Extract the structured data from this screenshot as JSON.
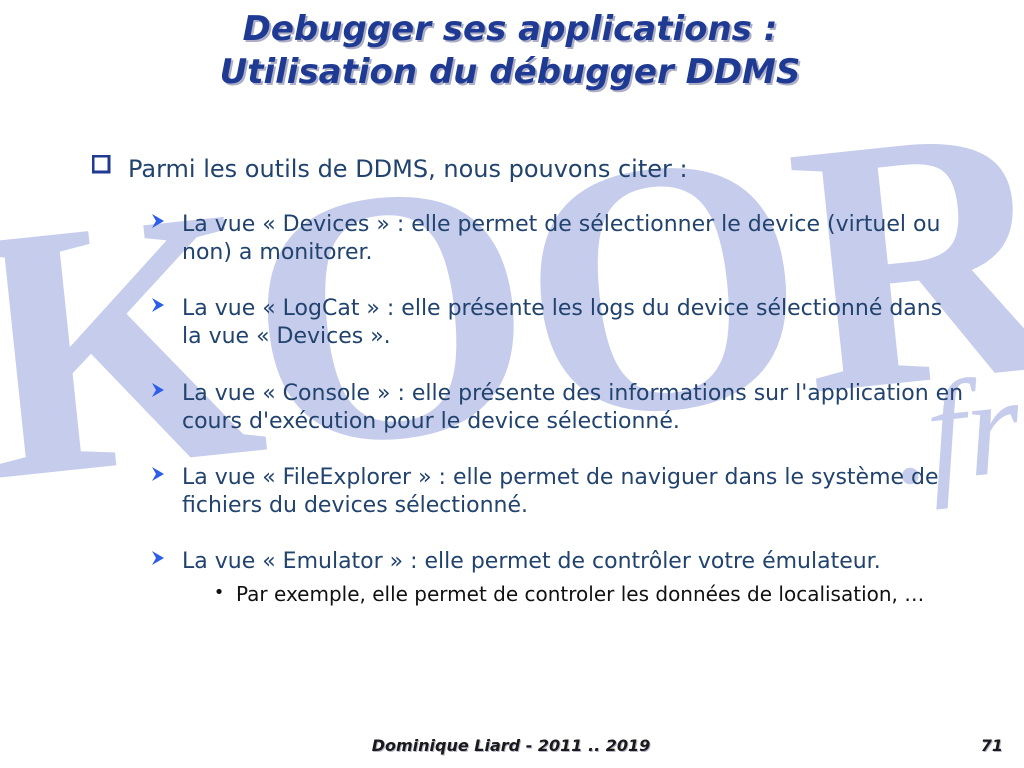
{
  "title_line1": "Debugger ses applications :",
  "title_line2": "Utilisation du débugger DDMS",
  "main_bullet": "Parmi les outils de DDMS, nous pouvons citer :",
  "items": [
    {
      "text": "La vue « Devices » : elle permet de sélectionner le device (virtuel ou non) a monitorer."
    },
    {
      "text": "La vue « LogCat » : elle présente les logs du device sélectionné dans la vue « Devices »."
    },
    {
      "text": "La vue « Console » : elle présente des informations sur l'application en cours d'exécution pour le device sélectionné."
    },
    {
      "text": "La vue « FileExplorer » : elle permet de naviguer dans le système de fichiers du devices sélectionné."
    },
    {
      "text": "La vue « Emulator » : elle permet de contrôler votre émulateur.",
      "sub": "Par exemple, elle permet de controler les données de localisation, …"
    }
  ],
  "footer_author": "Dominique Liard - 2011 .. 2019",
  "page_number": "71",
  "watermark_text": "KOOR.fr",
  "colors": {
    "title": "#1f3a93",
    "body_text": "#21436e",
    "arrow": "#2d5eea",
    "watermark": "#bcc2e7"
  }
}
